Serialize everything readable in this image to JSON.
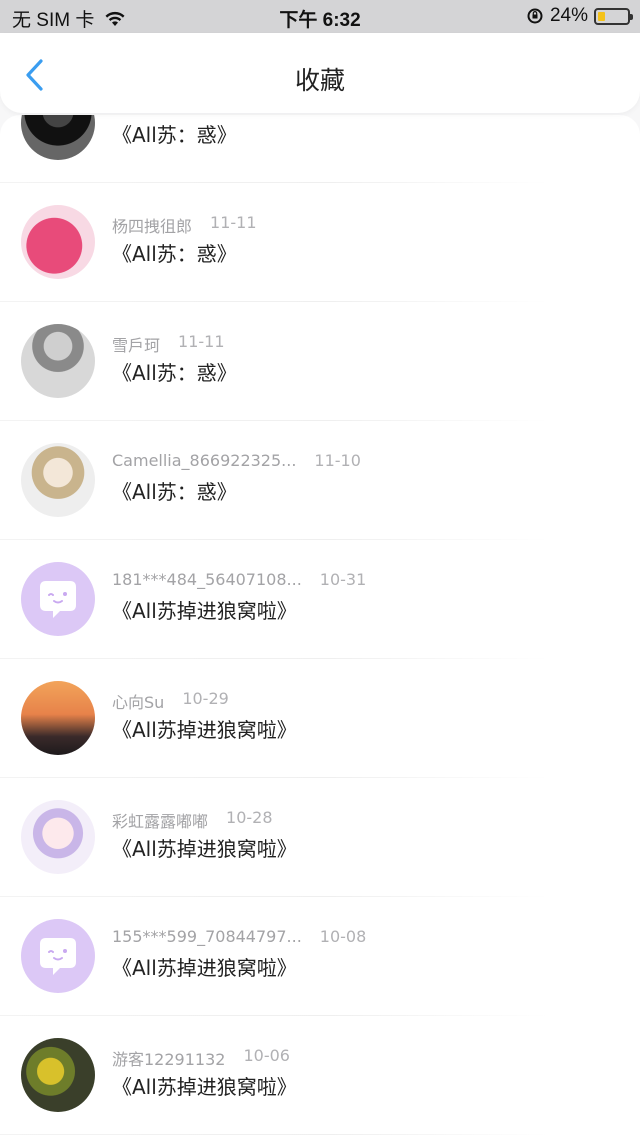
{
  "status_bar": {
    "carrier": "无 SIM 卡",
    "time": "下午 6:32",
    "battery": "24%"
  },
  "nav": {
    "title": "收藏"
  },
  "items": [
    {
      "author": "",
      "date": "",
      "title": "《All苏：惑》",
      "avatar": "grey-portrait"
    },
    {
      "author": "杨四拽徂郎",
      "date": "11-11",
      "title": "《All苏：惑》",
      "avatar": "pink-ball"
    },
    {
      "author": "雪戶珂",
      "date": "11-11",
      "title": "《All苏：惑》",
      "avatar": "bw-photo"
    },
    {
      "author": "Camellia_866922325...",
      "date": "11-10",
      "title": "《All苏：惑》",
      "avatar": "anime-blonde"
    },
    {
      "author": "181***484_56407108...",
      "date": "10-31",
      "title": "《All苏掉进狼窝啦》",
      "avatar": "default-chat"
    },
    {
      "author": "心向Su",
      "date": "10-29",
      "title": "《All苏掉进狼窝啦》",
      "avatar": "sunset-girl"
    },
    {
      "author": "彩虹露露嘟嘟",
      "date": "10-28",
      "title": "《All苏掉进狼窝啦》",
      "avatar": "anime-pink"
    },
    {
      "author": "155***599_70844797...",
      "date": "10-08",
      "title": "《All苏掉进狼窝啦》",
      "avatar": "default-chat"
    },
    {
      "author": "游客12291132",
      "date": "10-06",
      "title": "《All苏掉进狼窝啦》",
      "avatar": "flowers"
    }
  ],
  "colors": {
    "accent": "#3a9df0",
    "default_avatar": "#dcc8f6"
  }
}
